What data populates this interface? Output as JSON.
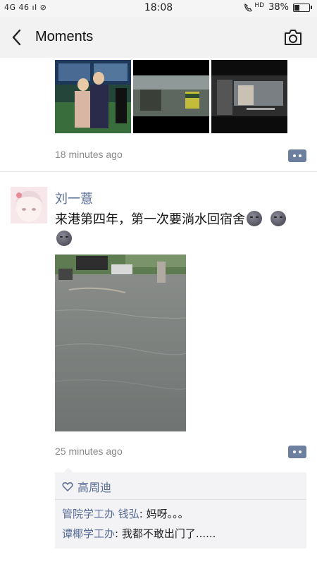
{
  "status_bar": {
    "signal": "4G 46 ıl ⊘",
    "time": "18:08",
    "volte": "HD",
    "battery_pct": "38%",
    "battery_level": 0.38
  },
  "header": {
    "title": "Moments"
  },
  "post_prev": {
    "time": "18 minutes ago"
  },
  "post": {
    "username": "刘一薏",
    "text": "来港第四年，第一次要淌水回宿舍",
    "time": "25 minutes ago",
    "likes": "高周迪",
    "comments": [
      {
        "author": "管院学工办 钱弘",
        "text": ": 妈呀。。。"
      },
      {
        "author": "谭椰学工办",
        "text": ": 我都不敢出门了......"
      }
    ]
  },
  "colors": {
    "link": "#576b95",
    "meta": "#8a8a8a",
    "more_button": "#6c7f9f"
  }
}
